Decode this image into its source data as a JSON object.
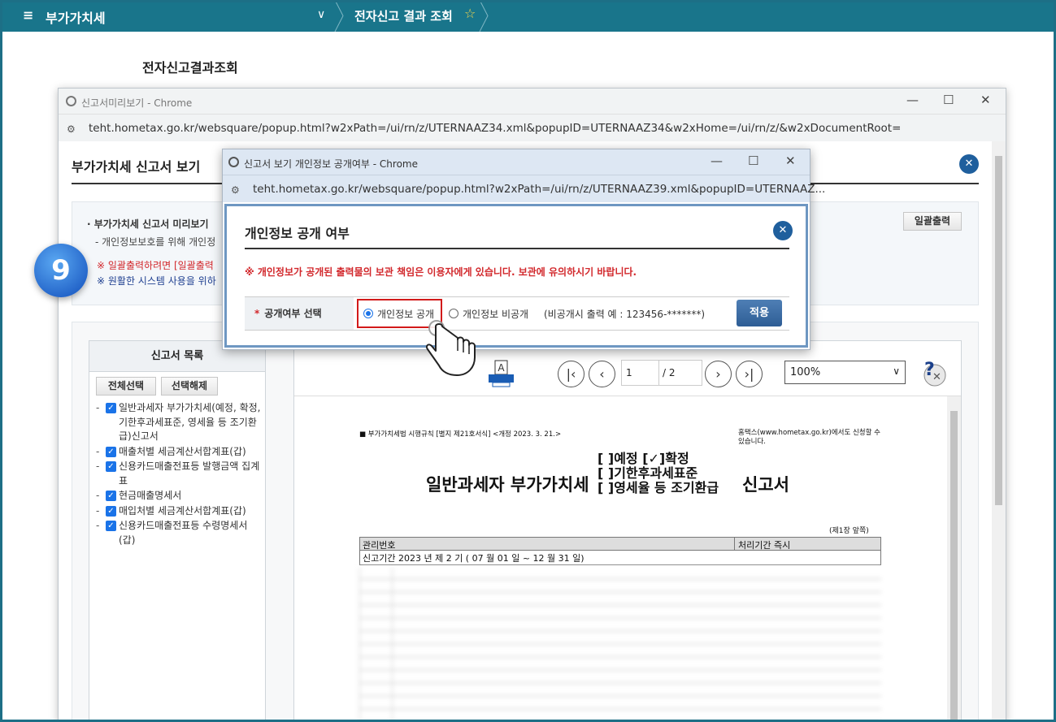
{
  "topnav": {
    "menu_icon": "≡",
    "section": "부가가치세",
    "chevron": "∨",
    "page": "전자신고 결과 조회",
    "star_icon": "☆"
  },
  "page_title": "전자신고결과조회",
  "popup1": {
    "title": "신고서미리보기 - Chrome",
    "url": "teht.hometax.go.kr/websquare/popup.html?w2xPath=/ui/rn/z/UTERNAAZ34.xml&popupID=UTERNAAZ34&w2xHome=/ui/rn/z/&w2xDocumentRoot=",
    "heading": "부가가치세 신고서 보기",
    "info": {
      "line1": "· 부가가치세 신고서 미리보기",
      "line2": "- 개인정보보호를 위해 개인정",
      "line3": "※ 일괄출력하려면 [일괄출력",
      "line4": "※ 원활한 시스템 사용을 위하"
    },
    "print_all_button": "일괄출력",
    "list": {
      "header": "신고서 목록",
      "select_all": "전체선택",
      "deselect": "선택해제",
      "items": [
        "일반과세자 부가가치세(예정, 확정, 기한후과세표준, 영세율 등 조기환급)신고서",
        "매출처별 세금계산서합계표(갑)",
        "신용카드매출전표등 발행금액 집계표",
        "현금매출명세서",
        "매입처별 세금계산서합계표(갑)",
        "신용카드매출전표등 수령명세서(갑)"
      ]
    },
    "viewer": {
      "page_current": "1",
      "page_total": "/ 2",
      "zoom": "100%",
      "doc": {
        "rule": "■ 부가가치세법 시행규칙 [별지 제21호서식] <개정 2023. 3. 21.>",
        "note": "홈택스(www.hometax.go.kr)에서도 신청할 수 있습니다.",
        "title_left": "일반과세자 부가가치세",
        "options": [
          "[ ]예정 [✓]확정",
          "[ ]기한후과세표준",
          "[ ]영세율 등 조기환급"
        ],
        "title_right": "신고서",
        "page_note": "(제1장 앞쪽)",
        "mgmt_label": "관리번호",
        "process_label": "처리기간 즉시",
        "period": "신고기간 2023 년 제 2 기 ( 07 월 01 일 ~ 12 월 31 일)"
      }
    }
  },
  "step_badge": "9",
  "popup2": {
    "title": "신고서 보기 개인정보 공개여부 - Chrome",
    "url": "teht.hometax.go.kr/websquare/popup.html?w2xPath=/ui/rn/z/UTERNAAZ39.xml&popupID=UTERNAAZ...",
    "heading": "개인정보 공개 여부",
    "warning": "※ 개인정보가 공개된 출력물의 보관 책임은 이용자에게 있습니다. 보관에 유의하시기 바랍니다.",
    "select_label": "공개여부 선택",
    "option_public": "개인정보 공개",
    "option_private": "개인정보 비공개",
    "private_example": "(비공개시 출력 예 : 123456-*******)",
    "apply_button": "적용"
  }
}
